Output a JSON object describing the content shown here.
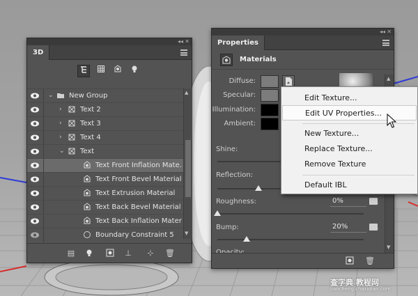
{
  "panel3d": {
    "title": "3D",
    "layers": [
      {
        "label": "New Group"
      },
      {
        "label": "Text 2"
      },
      {
        "label": "Text 3"
      },
      {
        "label": "Text 4"
      },
      {
        "label": "Text"
      },
      {
        "label": "Text Front Inflation Mate..."
      },
      {
        "label": "Text Front Bevel Material"
      },
      {
        "label": "Text Extrusion Material"
      },
      {
        "label": "Text Back Bevel Material"
      },
      {
        "label": "Text Back Inflation Mater..."
      },
      {
        "label": "Boundary Constraint 5"
      }
    ]
  },
  "properties": {
    "title": "Properties",
    "section": "Materials",
    "labels": {
      "diffuse": "Diffuse:",
      "specular": "Specular:",
      "illumination": "Illumination:",
      "ambient": "Ambient:",
      "shine": "Shine:",
      "reflection": "Reflection:",
      "roughness": "Roughness:",
      "bump": "Bump:",
      "opacity": "Opacity:"
    },
    "values": {
      "roughness": "0%",
      "bump": "20%"
    },
    "colors": {
      "diffuse": "#7c7c7c",
      "specular": "#7c7c7c",
      "illumination": "#000000",
      "ambient": "#000000"
    },
    "levels": {
      "reflection": 0.28,
      "roughness": 0.0,
      "bump": 0.2
    }
  },
  "context_menu": {
    "items": [
      {
        "label": "Edit Texture..."
      },
      {
        "label": "Edit UV Properties..."
      },
      {
        "label": "New Texture..."
      },
      {
        "label": "Replace Texture..."
      },
      {
        "label": "Remove Texture"
      },
      {
        "label": "Default IBL"
      }
    ]
  },
  "watermark": {
    "main": "查字典 教程网",
    "sub": "jiaocheng.chazidian.com"
  }
}
